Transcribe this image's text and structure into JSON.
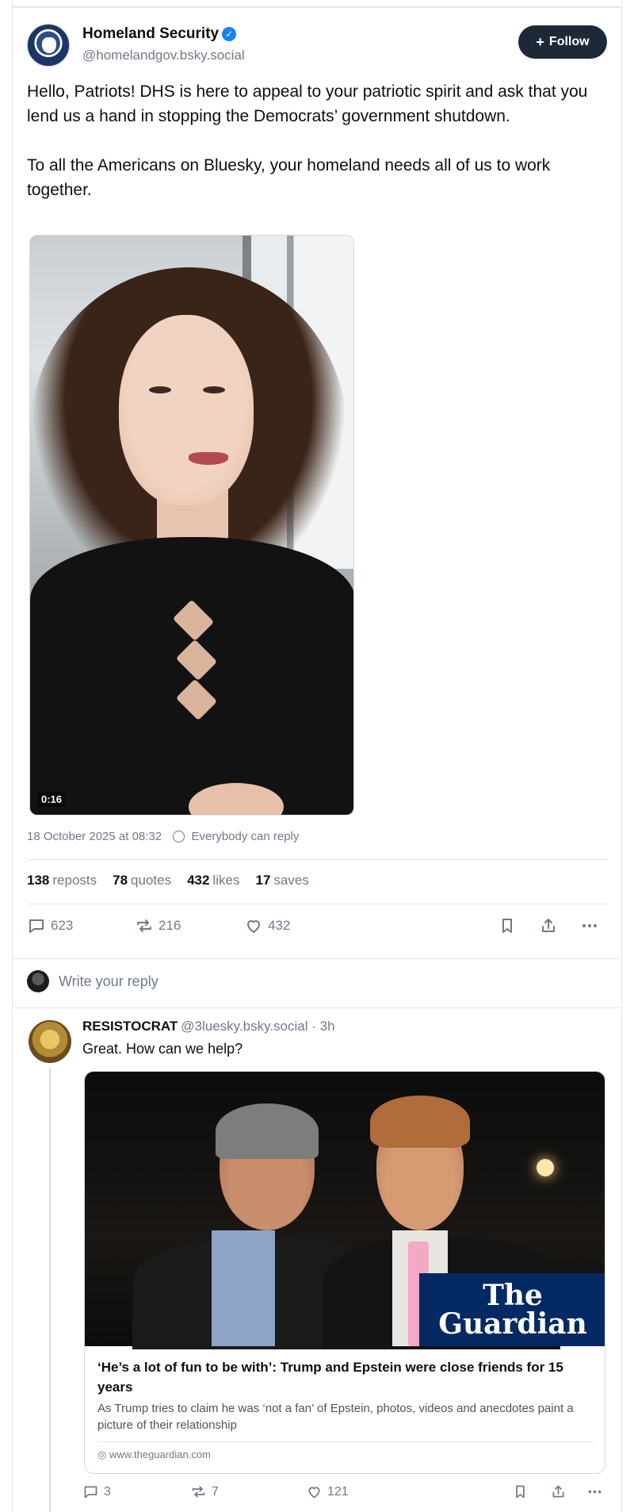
{
  "post": {
    "author_name": "Homeland Security",
    "author_handle": "@homelandgov.bsky.social",
    "follow_label": "Follow",
    "paragraphs": [
      "Hello, Patriots!  DHS is here to appeal to your patriotic spirit and ask that you lend us a hand in stopping the Democrats’ government shutdown.",
      "To all the Americans on Bluesky, your homeland needs all of us to work together."
    ],
    "video_time": "0:16",
    "timestamp": "18 October 2025 at 08:32",
    "reply_setting": "Everybody can reply",
    "stats": {
      "reposts_count": "138",
      "reposts_label": "reposts",
      "quotes_count": "78",
      "quotes_label": "quotes",
      "likes_count": "432",
      "likes_label": "likes",
      "saves_count": "17",
      "saves_label": "saves"
    },
    "actions": {
      "replies": "623",
      "reposts": "216",
      "likes": "432"
    }
  },
  "reply_box": {
    "placeholder": "Write your reply"
  },
  "reply": {
    "author_name": "RESISTOCRAT",
    "author_handle": "@3luesky.bsky.social",
    "time": "· 3h",
    "text": "Great. How can we help?",
    "card": {
      "logo_line1": "The",
      "logo_line2": "Guardian",
      "title": "‘He’s a lot of fun to be with’: Trump and Epstein were close friends for 15 years",
      "description": "As Trump tries to claim he was ‘not a fan’ of Epstein, photos, videos and anecdotes paint a picture of their relationship",
      "domain": "www.theguardian.com"
    },
    "actions": {
      "replies": "3",
      "reposts": "7",
      "likes": "121"
    }
  },
  "colors": {
    "follow_bg": "#1e2938",
    "verified": "#1083fe",
    "muted": "#6f7a88",
    "guardian_blue": "#052962"
  }
}
